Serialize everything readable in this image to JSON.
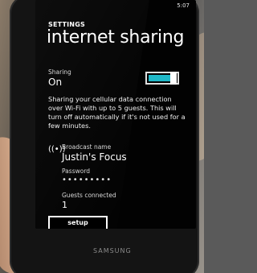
{
  "status_bar": {
    "time": "5:07"
  },
  "header": {
    "section": "SETTINGS",
    "title": "internet sharing"
  },
  "sharing": {
    "label": "Sharing",
    "state": "On",
    "accent_color": "#20b8c8"
  },
  "description": "Sharing your cellular data connection over Wi-Fi with up to 5 guests. This will turn off automatically if it's not used for a few minutes.",
  "broadcast": {
    "label": "Broadcast name",
    "value": "Justin's Focus",
    "icon": "broadcast-icon"
  },
  "password": {
    "label": "Password",
    "value": "•••••••••"
  },
  "guests": {
    "label": "Guests connected",
    "value": "1"
  },
  "setup_button": {
    "label": "setup"
  },
  "device": {
    "brand": "SAMSUNG"
  }
}
